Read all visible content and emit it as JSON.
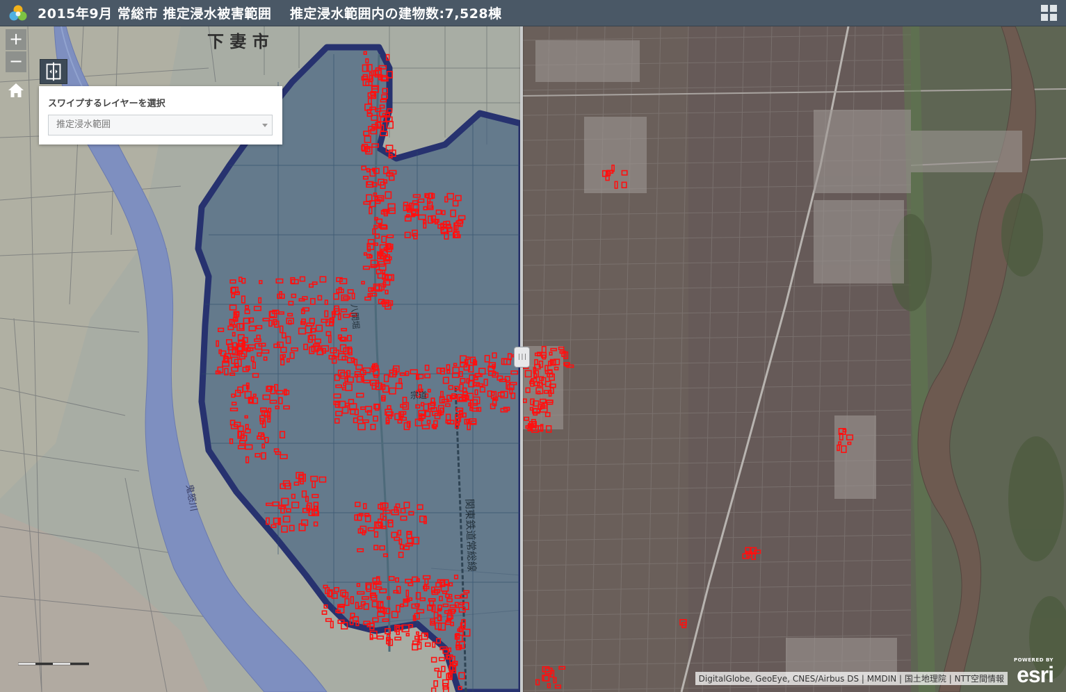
{
  "header": {
    "title": "2015年9月 常総市 推定浸水被害範囲　 推定浸水範囲内の建物数:7,528棟",
    "logo_icon": "cube-logo-icon",
    "apps_icon": "grid-apps-icon"
  },
  "map": {
    "left_basemap_text": {
      "city_label": "下 妻 市",
      "river_label": "鬼怒川",
      "railway_label": "関東鉄道常総線",
      "canal_label": "八間堀",
      "town_label": "宗道"
    }
  },
  "controls": {
    "zoom_in": "+",
    "zoom_out": "−",
    "home_icon": "home-icon",
    "swipe_tool_icon": "swipe-tool-icon",
    "swipe_handle": "|||"
  },
  "swipe_panel": {
    "label": "スワイプするレイヤーを選択",
    "selected_layer": "推定浸水範囲"
  },
  "attribution": "DigitalGlobe, GeoEye, CNES/Airbus DS | MMDIN | 国土地理院 | NTT空間情報",
  "esri": {
    "powered_by": "POWERED BY",
    "word": "esri"
  },
  "colors": {
    "header": "#4a5866",
    "flood_fill": "#3f5f80",
    "flood_outline": "#27326f",
    "buildings": "#ff1010",
    "river": "#7e8fc0"
  }
}
